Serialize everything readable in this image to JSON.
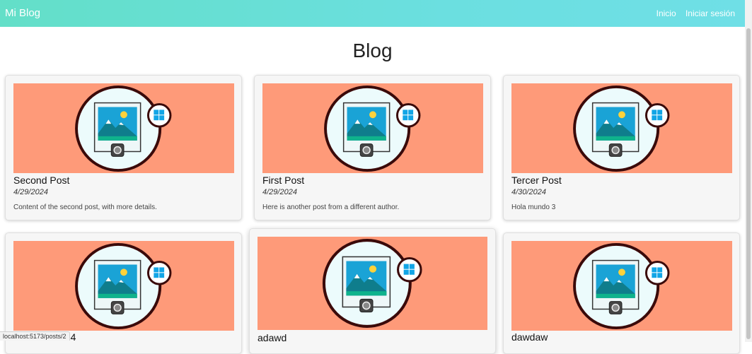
{
  "navbar": {
    "brand": "Mi Blog",
    "links": [
      "Inicio",
      "Iniciar sesión"
    ]
  },
  "page": {
    "title": "Blog"
  },
  "posts": [
    {
      "title": "Second Post",
      "date": "4/29/2024",
      "content": "Content of the second post, with more details."
    },
    {
      "title": "First Post",
      "date": "4/29/2024",
      "content": "Here is another post from a different author."
    },
    {
      "title": "Tercer Post",
      "date": "4/30/2024",
      "content": "Hola mundo 3"
    },
    {
      "title": "o 4",
      "date": "",
      "content": ""
    },
    {
      "title": "adawd",
      "date": "",
      "content": ""
    },
    {
      "title": "dawdaw",
      "date": "",
      "content": ""
    }
  ],
  "statusbar": {
    "url": "localhost:5173/posts/2"
  },
  "colors": {
    "accent": "#63dfc8",
    "thumb_bg": "#fe9a79"
  }
}
